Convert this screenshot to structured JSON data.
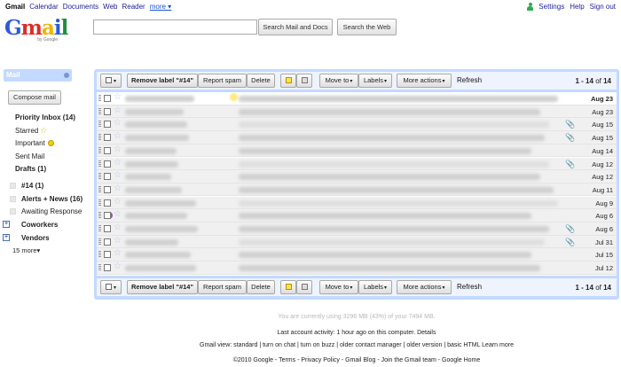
{
  "topnav": {
    "left": [
      "Gmail",
      "Calendar",
      "Documents",
      "Web",
      "Reader"
    ],
    "more": "more ▾",
    "right": [
      "Settings",
      "Help",
      "Sign out"
    ]
  },
  "logo": {
    "word": "Gmail",
    "by": "by Google"
  },
  "search": {
    "query": "",
    "mail_button": "Search Mail and Docs",
    "web_button": "Search the Web"
  },
  "sidebar": {
    "mail_tab": "Mail",
    "compose": "Compose mail",
    "items": [
      "Priority Inbox (14)",
      "Starred",
      "Important",
      "Sent Mail",
      "Drafts (1)"
    ],
    "labels": [
      "#14 (1)",
      "Alerts + News (16)",
      "Awaiting Response",
      "Coworkers",
      "Vendors"
    ],
    "more": "15 more▾"
  },
  "toolbar": {
    "remove_label": "Remove label \"#14\"",
    "report_spam": "Report spam",
    "delete": "Delete",
    "move_to": "Move to",
    "labels": "Labels",
    "more_actions": "More actions",
    "refresh": "Refresh",
    "pager_range": "1 - 14",
    "pager_of": "of",
    "pager_total": "14"
  },
  "emails": [
    {
      "date": "Aug 23",
      "unread": true,
      "attachment": false
    },
    {
      "date": "Aug 23",
      "unread": false,
      "attachment": false
    },
    {
      "date": "Aug 15",
      "unread": false,
      "attachment": true
    },
    {
      "date": "Aug 15",
      "unread": false,
      "attachment": true
    },
    {
      "date": "Aug 14",
      "unread": false,
      "attachment": false
    },
    {
      "date": "Aug 12",
      "unread": false,
      "attachment": true
    },
    {
      "date": "Aug 12",
      "unread": false,
      "attachment": false
    },
    {
      "date": "Aug 11",
      "unread": false,
      "attachment": false
    },
    {
      "date": "Aug 9",
      "unread": false,
      "attachment": false
    },
    {
      "date": "Aug 6",
      "unread": false,
      "attachment": false
    },
    {
      "date": "Aug 6",
      "unread": false,
      "attachment": true
    },
    {
      "date": "Jul 31",
      "unread": false,
      "attachment": true
    },
    {
      "date": "Jul 15",
      "unread": false,
      "attachment": false
    },
    {
      "date": "Jul 12",
      "unread": false,
      "attachment": false
    }
  ],
  "footer": {
    "storage": "You are currently using 3296 MB (43%) of your 7494 MB.",
    "activity": "Last account activity: 1 hour ago on this computer.  Details",
    "view": "Gmail view: standard | turn on chat | turn on buzz | older contact manager | older version | basic HTML  Learn more",
    "copyright": "©2010 Google - Terms - Privacy Policy - Gmail Blog - Join the Gmail team - Google Home"
  }
}
